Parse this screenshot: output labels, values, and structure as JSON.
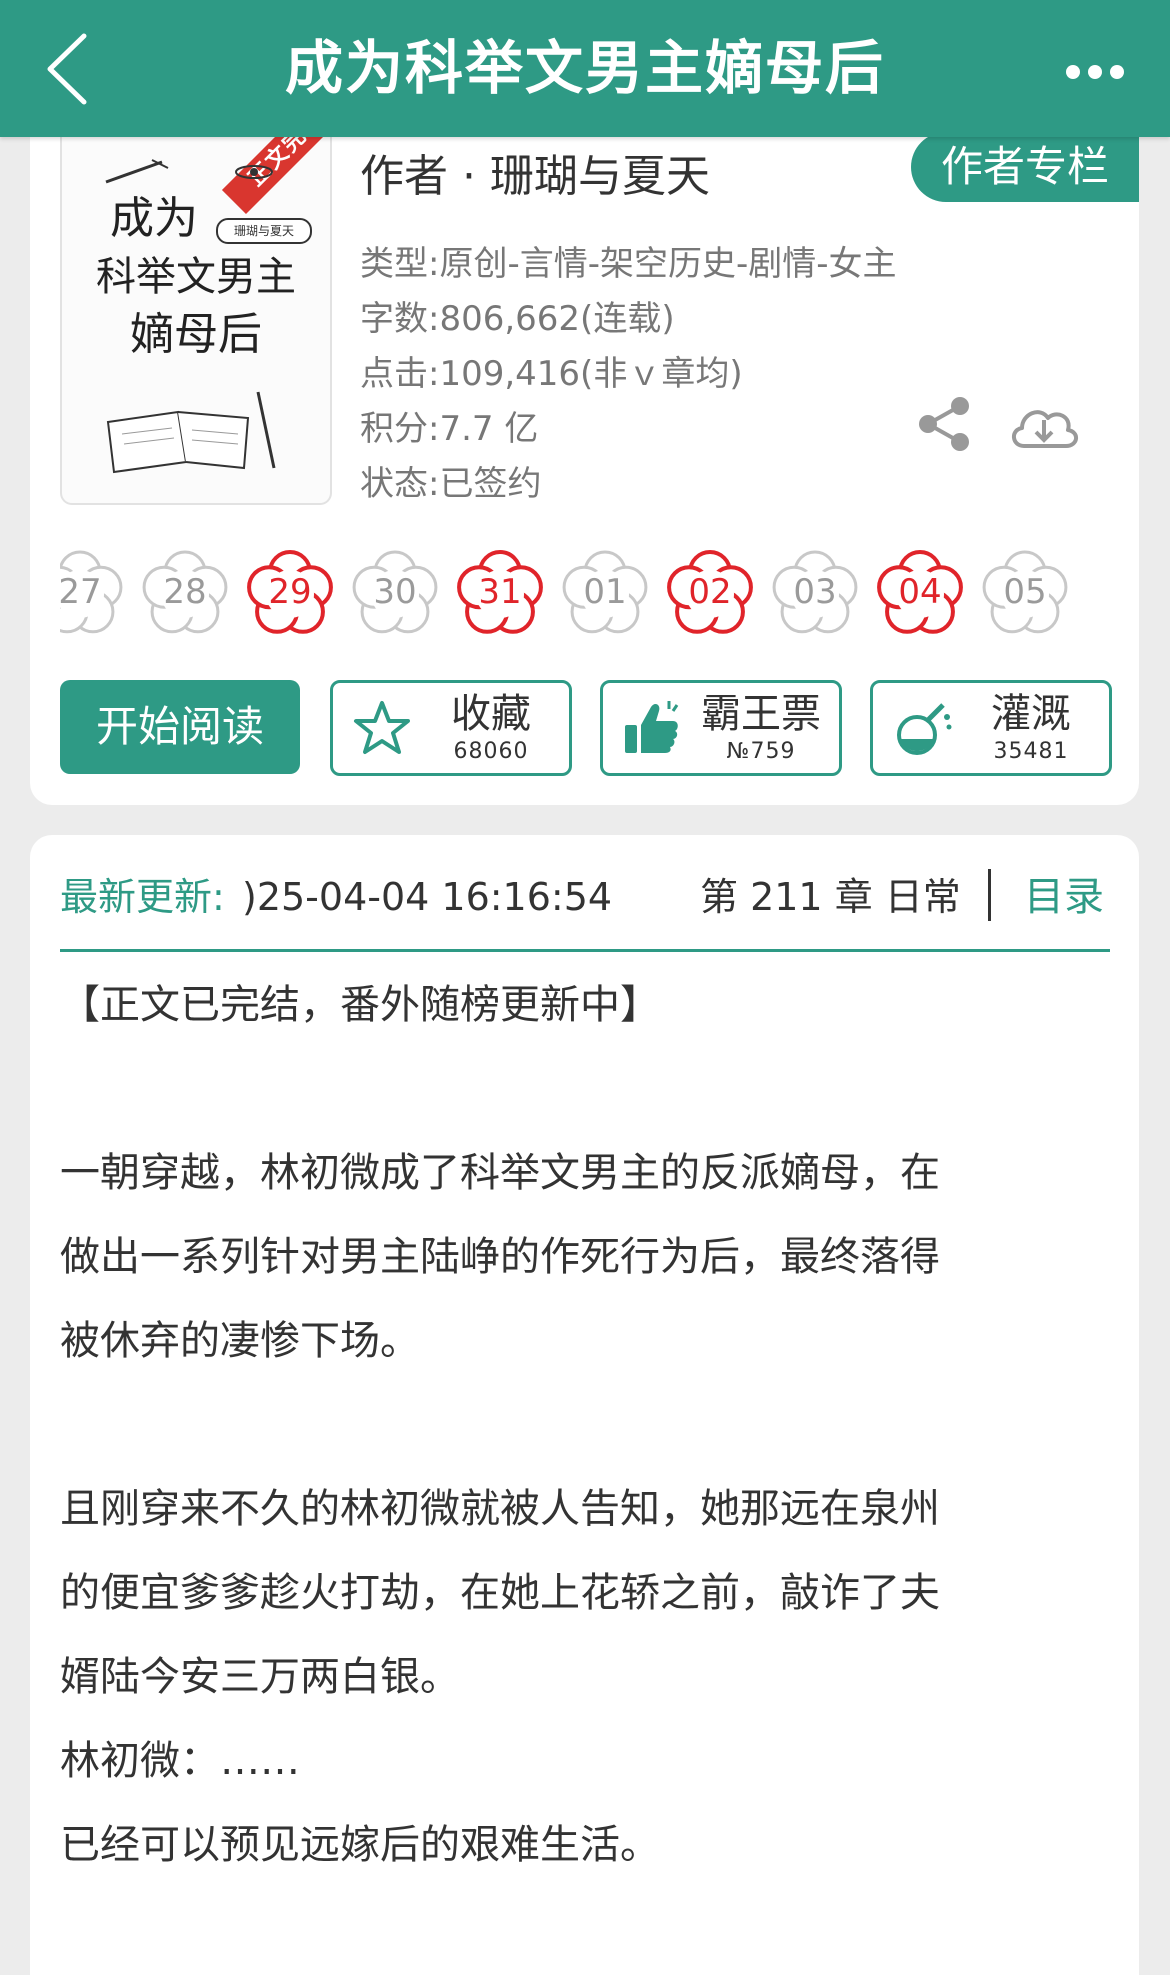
{
  "header": {
    "title": "成为科举文男主嫡母后",
    "back_icon": "chevron-left-icon",
    "more_icon": "more-dots-icon"
  },
  "book": {
    "cover": {
      "ribbon": "正文完结",
      "title_line1": "成为",
      "title_line2": "科举文男主",
      "title_line3": "嫡母后",
      "author_tag": "珊瑚与夏天"
    },
    "author": "作者 · 珊瑚与夏天",
    "author_column_label": "作者专栏",
    "type": "类型:原创-言情-架空历史-剧情-女主",
    "words": "字数:806,662(连载)",
    "clicks": "点击:109,416(非ｖ章均)",
    "score": "积分:7.7 亿",
    "status": "状态:已签约",
    "share_icon": "share-icon",
    "download_icon": "download-cloud-icon"
  },
  "calendar": [
    {
      "day": "27",
      "active": false
    },
    {
      "day": "28",
      "active": false
    },
    {
      "day": "29",
      "active": true
    },
    {
      "day": "30",
      "active": false
    },
    {
      "day": "31",
      "active": true
    },
    {
      "day": "01",
      "active": false
    },
    {
      "day": "02",
      "active": true
    },
    {
      "day": "03",
      "active": false
    },
    {
      "day": "04",
      "active": true
    },
    {
      "day": "05",
      "active": false
    }
  ],
  "actions": {
    "read_label": "开始阅读",
    "favorite": {
      "label": "收藏",
      "count": "68060",
      "icon": "star-icon"
    },
    "ticket": {
      "label": "霸王票",
      "count": "№759",
      "icon": "thumbs-up-icon"
    },
    "water": {
      "label": "灌溉",
      "count": "35481",
      "icon": "watering-flask-icon"
    }
  },
  "update": {
    "label": "最新更新:",
    "time": ")25-04-04 16:16:54",
    "chapter": "第 211 章 日常",
    "toc_label": "目录"
  },
  "description": [
    "【正文已完结，番外随榜更新中】",
    "",
    "一朝穿越，林初微成了科举文男主的反派嫡母，在",
    "做出一系列针对男主陆峥的作死行为后，最终落得",
    "被休弃的凄惨下场。",
    "",
    "且刚穿来不久的林初微就被人告知，她那远在泉州",
    "的便宜爹爹趁火打劫，在她上花轿之前，敲诈了夫",
    "婿陆今安三万两白银。",
    "林初微：……",
    "已经可以预见远嫁后的艰难生活。"
  ],
  "colors": {
    "accent": "#2e9a85",
    "active_flower": "#e0242a",
    "inactive_flower": "#c8c8c8"
  }
}
